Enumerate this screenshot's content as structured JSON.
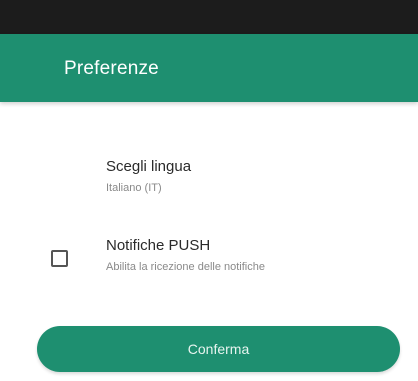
{
  "app_bar": {
    "title": "Preferenze"
  },
  "preferences": {
    "language": {
      "title": "Scegli lingua",
      "summary": "Italiano (IT)"
    },
    "push": {
      "title": "Notifiche PUSH",
      "summary": "Abilita la ricezione delle notifiche",
      "checked": false
    }
  },
  "actions": {
    "confirm_label": "Conferma"
  },
  "colors": {
    "primary": "#1e8f70",
    "status_bar": "#1c1c1c"
  }
}
